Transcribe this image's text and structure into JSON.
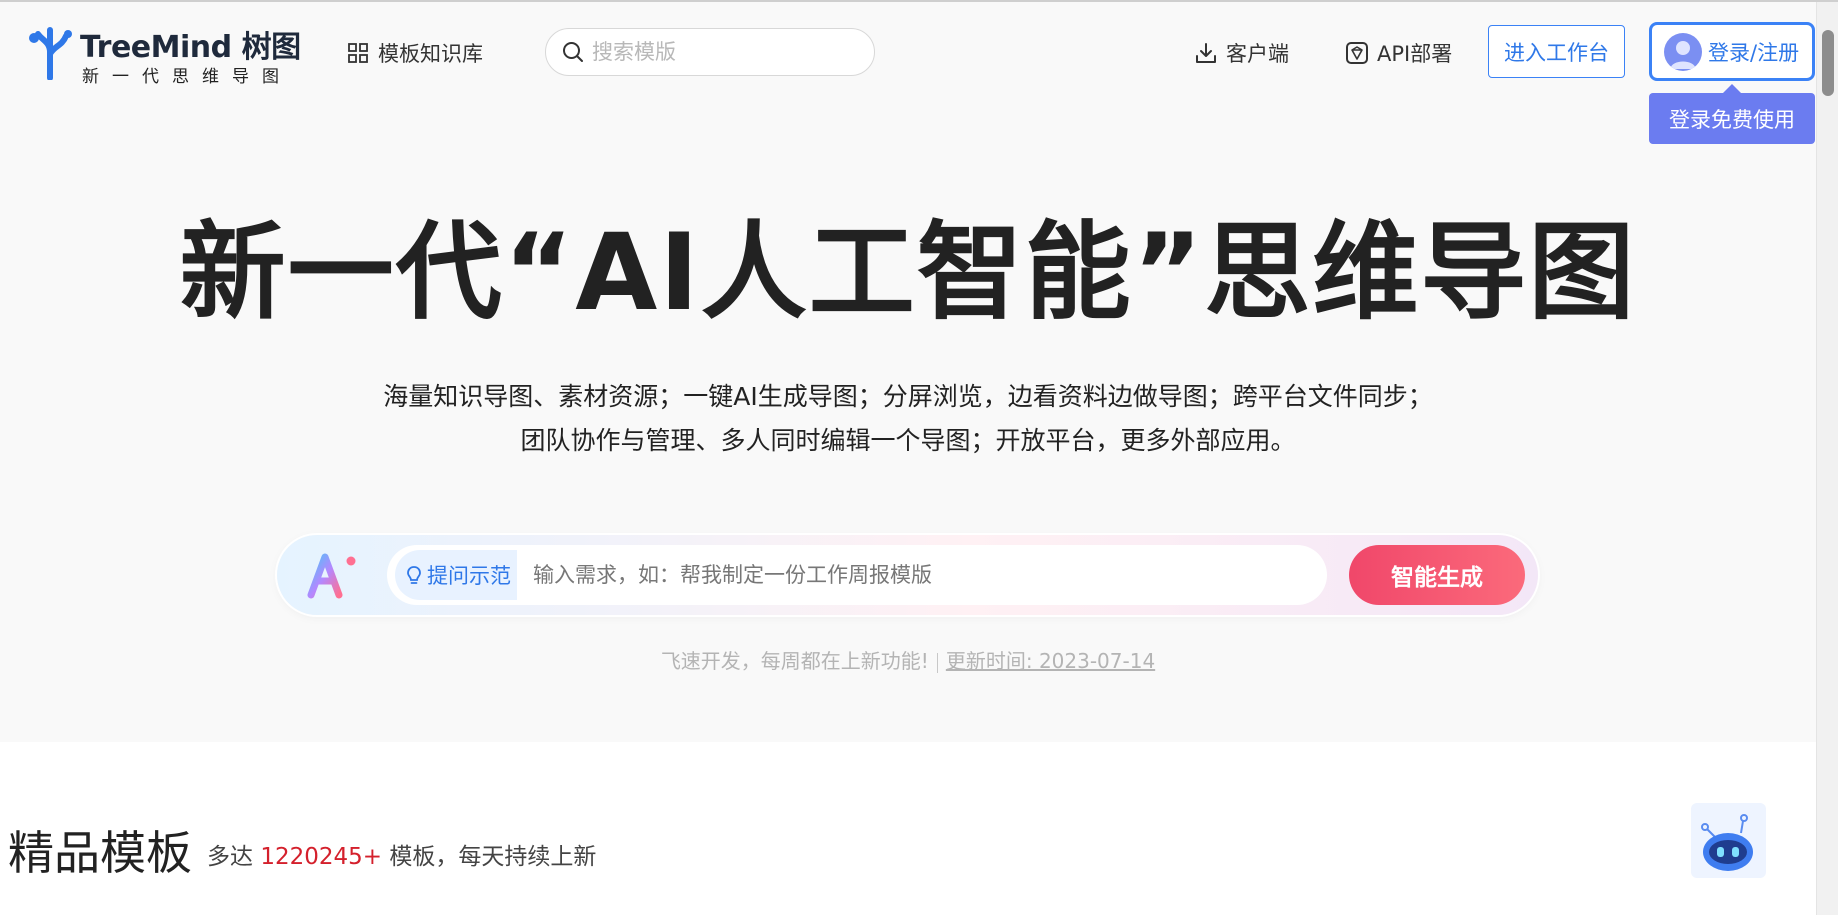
{
  "brand": {
    "name": "TreeMind 树图",
    "tagline": "新一代思维导图"
  },
  "header": {
    "templates_link": "模板知识库",
    "search_placeholder": "搜索模版",
    "client_link": "客户端",
    "api_link": "API部署",
    "workspace_button": "进入工作台",
    "login_button": "登录/注册",
    "login_tooltip": "登录免费使用"
  },
  "hero": {
    "title": "新一代“AI人工智能”思维导图",
    "subtitle_line1": "海量知识导图、素材资源；一键AI生成导图；分屏浏览，边看资料边做导图；跨平台文件同步；",
    "subtitle_line2": "团队协作与管理、多人同时编辑一个导图；开放平台，更多外部应用。"
  },
  "ai_bar": {
    "ask_example": "提问示范",
    "input_placeholder": "输入需求，如：帮我制定一份工作周报模版",
    "generate_button": "智能生成"
  },
  "update": {
    "text": "飞速开发，每周都在上新功能!",
    "time": "更新时间: 2023-07-14"
  },
  "section": {
    "title": "精品模板",
    "sub_prefix": "多达",
    "count": "1220245+",
    "sub_suffix": "模板，每天持续上新"
  },
  "colors": {
    "accent": "#3b82f6",
    "tooltip": "#6b7cf0",
    "generate": "#f0476a",
    "count": "#d4202c"
  }
}
